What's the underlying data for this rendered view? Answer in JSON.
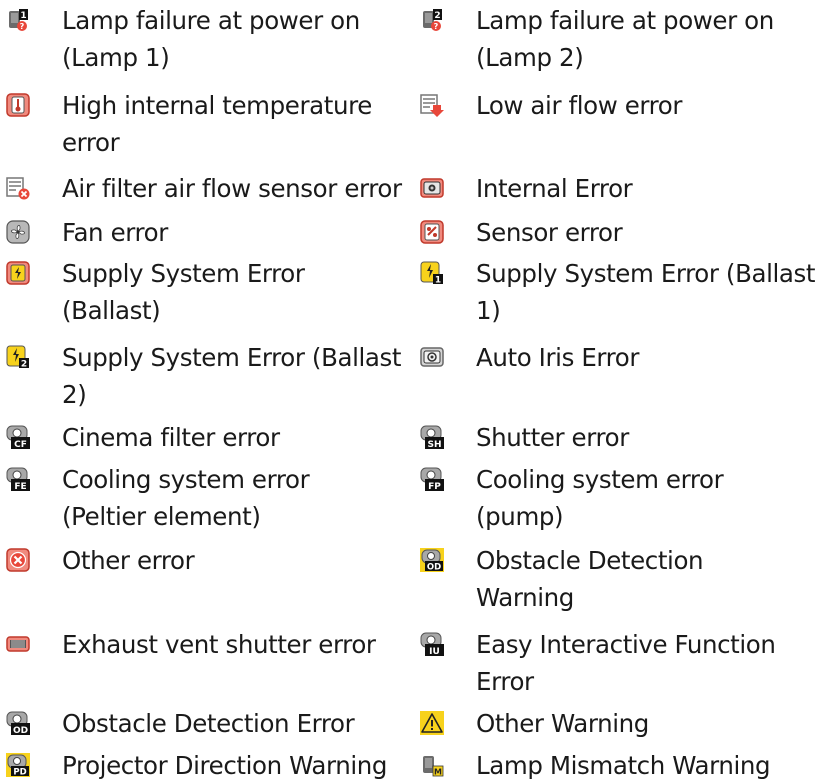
{
  "items": [
    {
      "label": "Lamp failure at power on\n(Lamp 1)",
      "icon": "lamp-1-failure-icon"
    },
    {
      "label": "Lamp failure at power on\n(Lamp 2)",
      "icon": "lamp-2-failure-icon"
    },
    {
      "label": "High internal temperature\nerror",
      "icon": "thermometer-icon"
    },
    {
      "label": "Low air flow error",
      "icon": "low-air-flow-icon"
    },
    {
      "label": "Air filter air flow sensor error",
      "icon": "air-filter-sensor-icon"
    },
    {
      "label": "Internal Error",
      "icon": "internal-error-icon"
    },
    {
      "label": "Fan error",
      "icon": "fan-icon"
    },
    {
      "label": "Sensor error",
      "icon": "sensor-icon"
    },
    {
      "label": "Supply System Error\n(Ballast)",
      "icon": "supply-ballast-icon"
    },
    {
      "label": "Supply System Error (Ballast\n1)",
      "icon": "supply-ballast-1-icon"
    },
    {
      "label": "Supply System Error (Ballast\n2)",
      "icon": "supply-ballast-2-icon"
    },
    {
      "label": "Auto Iris Error",
      "icon": "auto-iris-icon"
    },
    {
      "label": "Cinema filter error",
      "icon": "cinema-filter-icon",
      "badge": "CF"
    },
    {
      "label": "Shutter error",
      "icon": "shutter-icon",
      "badge": "SH"
    },
    {
      "label": "Cooling system error\n(Peltier element)",
      "icon": "cooling-peltier-icon",
      "badge": "FE"
    },
    {
      "label": "Cooling system error\n(pump)",
      "icon": "cooling-pump-icon",
      "badge": "FP"
    },
    {
      "label": "Other error",
      "icon": "other-error-icon"
    },
    {
      "label": "Obstacle Detection\nWarning",
      "icon": "obstacle-warning-icon",
      "badge": "OD"
    },
    {
      "label": "Exhaust vent shutter error",
      "icon": "exhaust-vent-icon"
    },
    {
      "label": "Easy Interactive Function\nError",
      "icon": "easy-interactive-icon",
      "badge": "IU"
    },
    {
      "label": "Obstacle Detection Error",
      "icon": "obstacle-error-icon",
      "badge": "OD"
    },
    {
      "label": "Other Warning",
      "icon": "warning-triangle-icon"
    },
    {
      "label": "Projector Direction Warning",
      "icon": "projector-direction-icon",
      "badge": "PD"
    },
    {
      "label": "Lamp Mismatch Warning",
      "icon": "lamp-mismatch-icon"
    }
  ],
  "colors": {
    "icon_red": "#e8473a",
    "icon_dark": "#2a2a2a",
    "warning_yellow": "#f7d21c",
    "text": "#1a1a1a"
  }
}
